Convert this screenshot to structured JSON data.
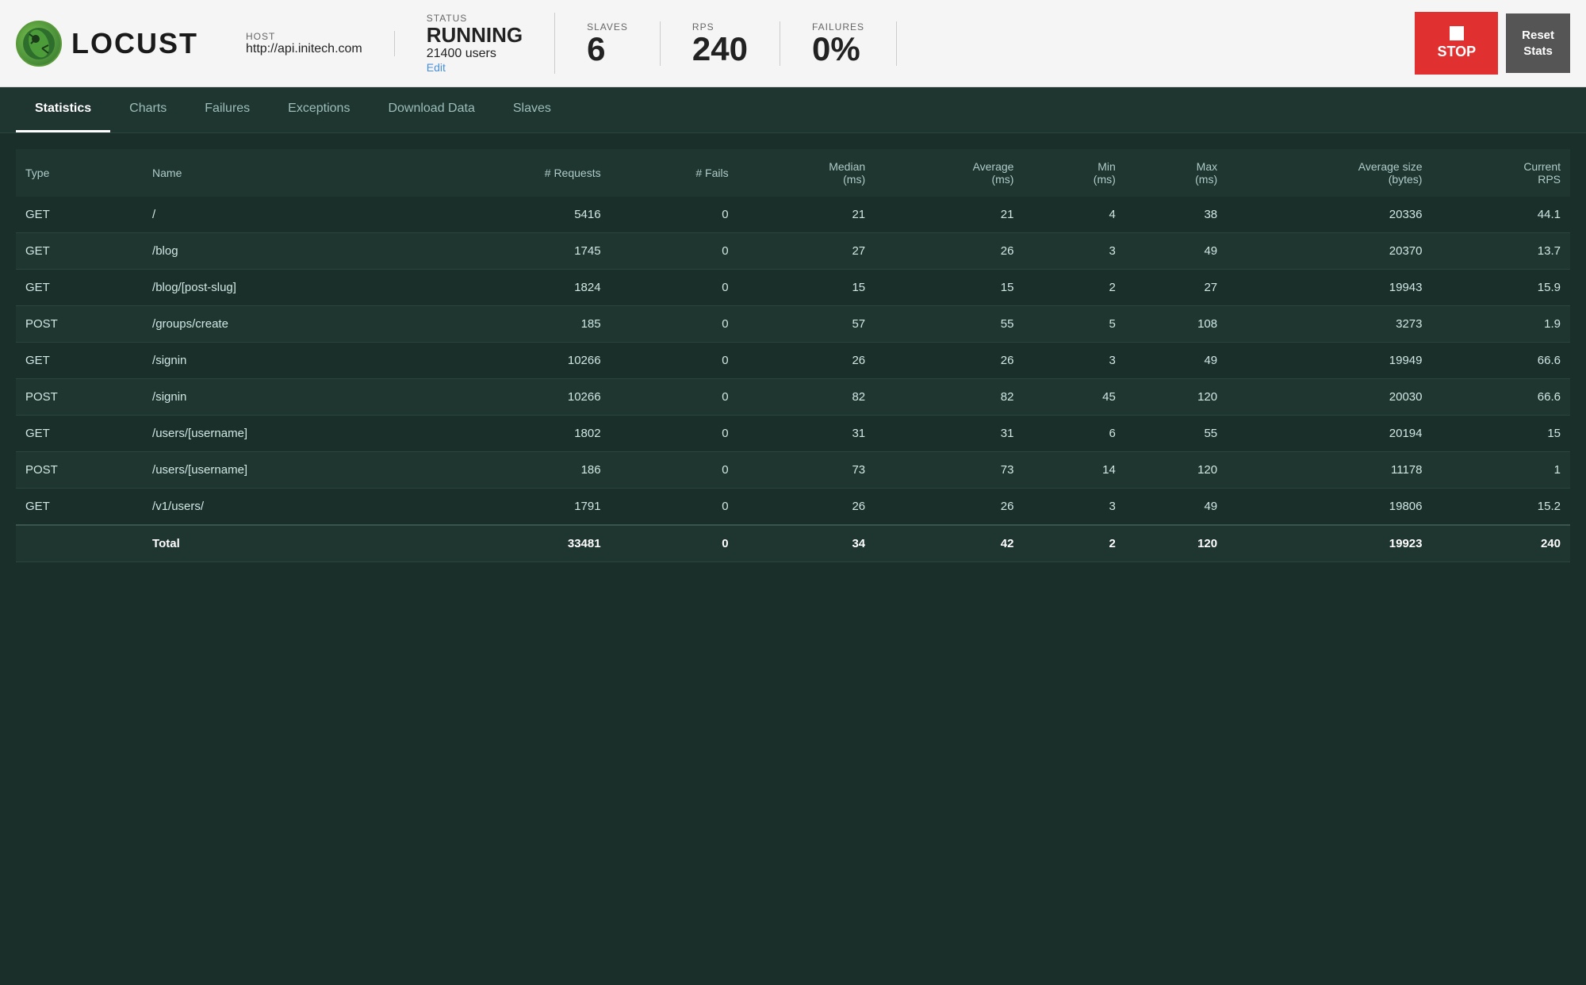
{
  "header": {
    "logo_text": "LOCUST",
    "host_label": "HOST",
    "host_value": "http://api.initech.com",
    "status_label": "STATUS",
    "status_value": "RUNNING",
    "users_value": "21400 users",
    "edit_label": "Edit",
    "slaves_label": "SLAVES",
    "slaves_value": "6",
    "rps_label": "RPS",
    "rps_value": "240",
    "failures_label": "FAILURES",
    "failures_value": "0%",
    "stop_button": "STOP",
    "reset_button": "Reset\nStats"
  },
  "nav": {
    "tabs": [
      {
        "label": "Statistics",
        "active": true
      },
      {
        "label": "Charts",
        "active": false
      },
      {
        "label": "Failures",
        "active": false
      },
      {
        "label": "Exceptions",
        "active": false
      },
      {
        "label": "Download Data",
        "active": false
      },
      {
        "label": "Slaves",
        "active": false
      }
    ]
  },
  "table": {
    "columns": [
      "Type",
      "Name",
      "# Requests",
      "# Fails",
      "Median\n(ms)",
      "Average\n(ms)",
      "Min\n(ms)",
      "Max\n(ms)",
      "Average size\n(bytes)",
      "Current\nRPS"
    ],
    "rows": [
      {
        "type": "GET",
        "name": "/",
        "requests": "5416",
        "fails": "0",
        "median": "21",
        "avg": "21",
        "min": "4",
        "max": "38",
        "avg_size": "20336",
        "rps": "44.1"
      },
      {
        "type": "GET",
        "name": "/blog",
        "requests": "1745",
        "fails": "0",
        "median": "27",
        "avg": "26",
        "min": "3",
        "max": "49",
        "avg_size": "20370",
        "rps": "13.7"
      },
      {
        "type": "GET",
        "name": "/blog/[post-slug]",
        "requests": "1824",
        "fails": "0",
        "median": "15",
        "avg": "15",
        "min": "2",
        "max": "27",
        "avg_size": "19943",
        "rps": "15.9"
      },
      {
        "type": "POST",
        "name": "/groups/create",
        "requests": "185",
        "fails": "0",
        "median": "57",
        "avg": "55",
        "min": "5",
        "max": "108",
        "avg_size": "3273",
        "rps": "1.9"
      },
      {
        "type": "GET",
        "name": "/signin",
        "requests": "10266",
        "fails": "0",
        "median": "26",
        "avg": "26",
        "min": "3",
        "max": "49",
        "avg_size": "19949",
        "rps": "66.6"
      },
      {
        "type": "POST",
        "name": "/signin",
        "requests": "10266",
        "fails": "0",
        "median": "82",
        "avg": "82",
        "min": "45",
        "max": "120",
        "avg_size": "20030",
        "rps": "66.6"
      },
      {
        "type": "GET",
        "name": "/users/[username]",
        "requests": "1802",
        "fails": "0",
        "median": "31",
        "avg": "31",
        "min": "6",
        "max": "55",
        "avg_size": "20194",
        "rps": "15"
      },
      {
        "type": "POST",
        "name": "/users/[username]",
        "requests": "186",
        "fails": "0",
        "median": "73",
        "avg": "73",
        "min": "14",
        "max": "120",
        "avg_size": "11178",
        "rps": "1"
      },
      {
        "type": "GET",
        "name": "/v1/users/",
        "requests": "1791",
        "fails": "0",
        "median": "26",
        "avg": "26",
        "min": "3",
        "max": "49",
        "avg_size": "19806",
        "rps": "15.2"
      }
    ],
    "total": {
      "label": "Total",
      "requests": "33481",
      "fails": "0",
      "median": "34",
      "avg": "42",
      "min": "2",
      "max": "120",
      "avg_size": "19923",
      "rps": "240"
    }
  }
}
